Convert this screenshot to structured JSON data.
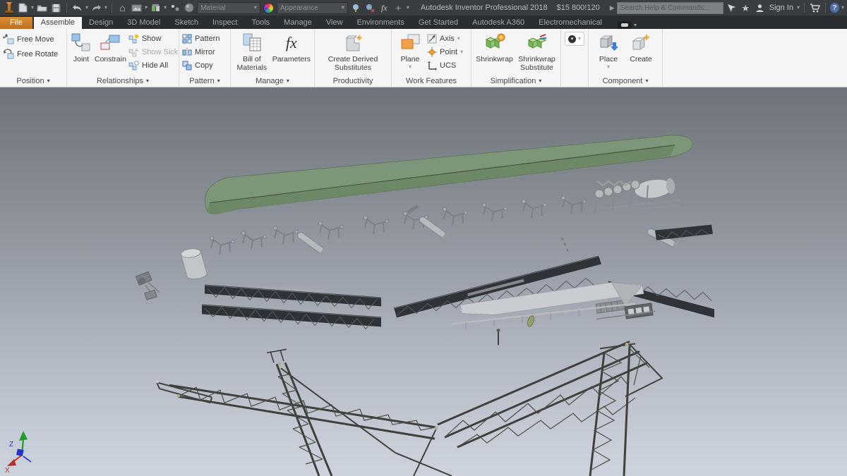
{
  "titlebar": {
    "app_title": "Autodesk Inventor Professional 2018",
    "document_name": "$15 800!120",
    "material_label": "Material",
    "appearance_label": "Appearance",
    "search_placeholder": "Search Help & Commands...",
    "sign_in_label": "Sign In"
  },
  "tabs": {
    "active": "Assemble",
    "items": [
      "File",
      "Assemble",
      "Design",
      "3D Model",
      "Sketch",
      "Inspect",
      "Tools",
      "Manage",
      "View",
      "Environments",
      "Get Started",
      "Autodesk A360",
      "Electromechanical"
    ]
  },
  "ribbon": {
    "position": {
      "label": "Position",
      "free_move": "Free Move",
      "free_rotate": "Free Rotate"
    },
    "relationships": {
      "label": "Relationships",
      "joint": "Joint",
      "constrain": "Constrain",
      "show": "Show",
      "show_sick": "Show Sick",
      "hide_all": "Hide All"
    },
    "pattern_group": {
      "label": "Pattern",
      "pattern": "Pattern",
      "mirror": "Mirror",
      "copy": "Copy"
    },
    "manage_group": {
      "label": "Manage",
      "bill_of_materials": "Bill of Materials",
      "parameters": "Parameters"
    },
    "productivity": {
      "label": "Productivity",
      "create_derived_substitutes": "Create Derived Substitutes"
    },
    "work_features": {
      "label": "Work Features",
      "plane": "Plane",
      "axis": "Axis",
      "point": "Point",
      "ucs": "UCS"
    },
    "simplification": {
      "label": "Simplification",
      "shrinkwrap": "Shrinkwrap",
      "shrinkwrap_substitute": "Shrinkwrap Substitute"
    },
    "component": {
      "label": "Component",
      "place": "Place",
      "create": "Create"
    }
  },
  "viewport": {
    "x_axis_label": "X",
    "z_axis_label": "Z"
  },
  "glyphs": {
    "caret_down": "▾",
    "caret_right": "▶",
    "star": "★",
    "home": "⌂",
    "plus": "+",
    "help": "?",
    "fx": "fx"
  },
  "colors": {
    "file_tab_orange": "#c77f2f",
    "blade_green": "#7b9377",
    "titlebar_gray": "#3a3d40",
    "ribbon_bg": "#f5f5f6",
    "viewport_top": "#6f737a",
    "viewport_bottom": "#cdd3dc"
  }
}
